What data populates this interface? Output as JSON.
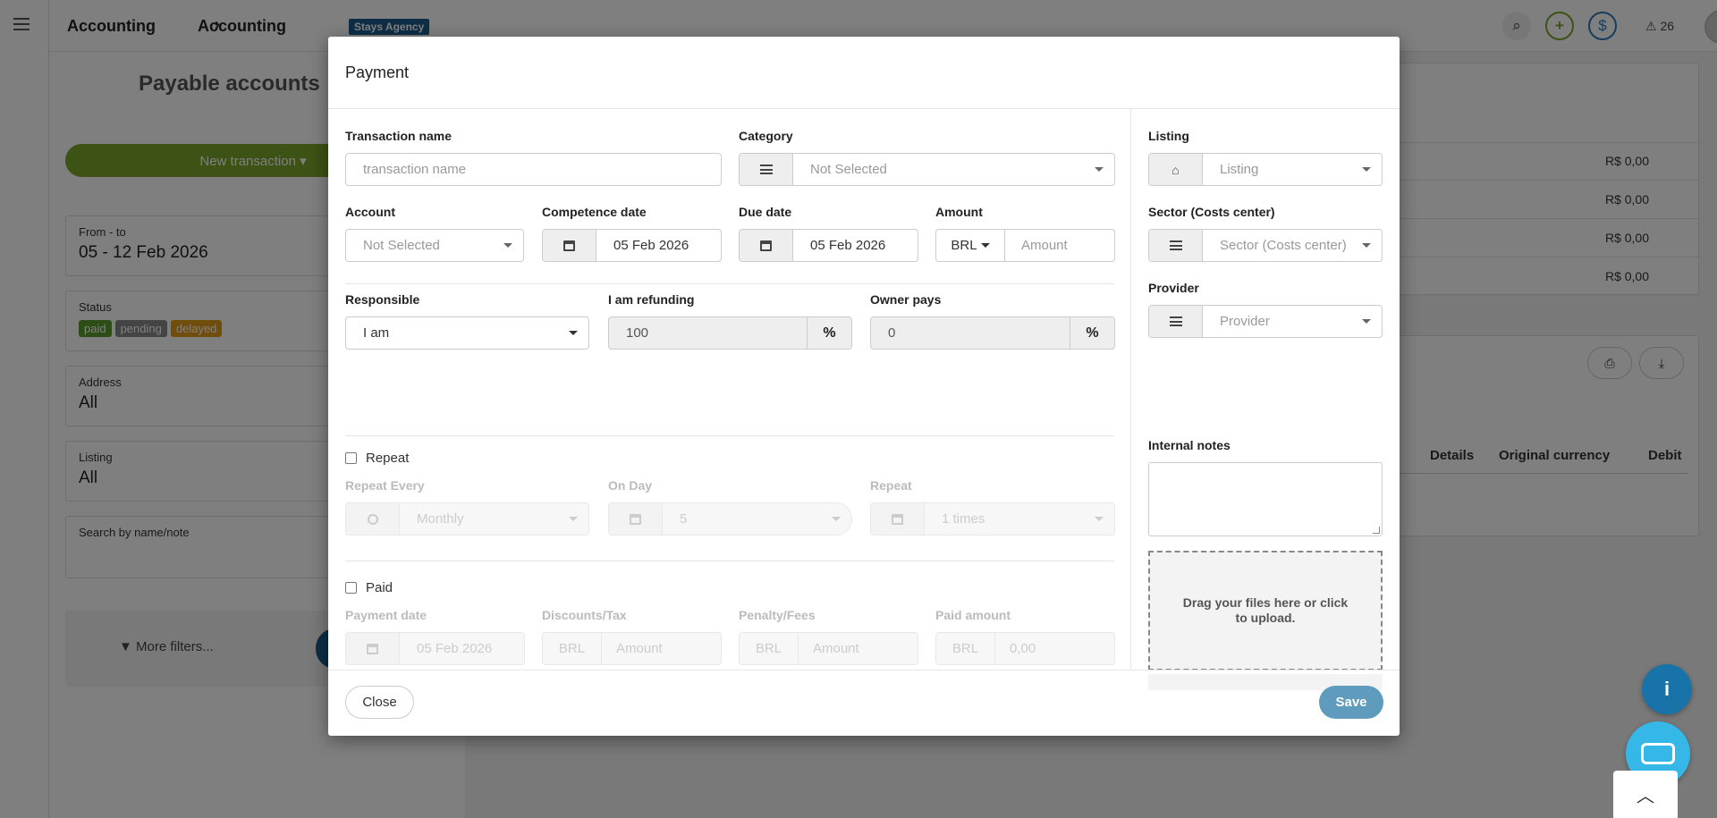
{
  "app": {
    "breadcrumb": [
      "Accounting",
      "Accounting"
    ],
    "breadcrumb_separator": "›",
    "agency_badge": "Stays Agency",
    "alerts_count": "26"
  },
  "sidebar": {
    "title": "Payable accounts",
    "new_transaction": "New transaction ▾",
    "filters": {
      "date": {
        "label": "From - to",
        "value": "05 - 12 Feb 2026"
      },
      "status": {
        "label": "Status",
        "tags": [
          "paid",
          "pending",
          "delayed"
        ]
      },
      "address": {
        "label": "Address",
        "value": "All"
      },
      "listing": {
        "label": "Listing",
        "value": "All"
      },
      "search": {
        "label": "Search by name/note"
      }
    },
    "more_filters": "More filters..."
  },
  "background": {
    "values": [
      "R$ 0,00",
      "R$ 0,00",
      "R$ 0,00",
      "R$ 0,00"
    ],
    "columns": [
      "Details",
      "Original currency",
      "Debit"
    ]
  },
  "modal": {
    "title": "Payment",
    "transaction_name": {
      "label": "Transaction name",
      "placeholder": "transaction name"
    },
    "category": {
      "label": "Category",
      "value": "Not Selected"
    },
    "account": {
      "label": "Account",
      "value": "Not Selected"
    },
    "competence_date": {
      "label": "Competence date",
      "value": "05 Feb 2026"
    },
    "due_date": {
      "label": "Due date",
      "value": "05 Feb 2026"
    },
    "amount": {
      "label": "Amount",
      "currency": "BRL",
      "placeholder": "Amount"
    },
    "responsible": {
      "label": "Responsible",
      "value": "I am"
    },
    "refunding": {
      "label": "I am refunding",
      "value": "100",
      "unit": "%"
    },
    "owner_pays": {
      "label": "Owner pays",
      "value": "0",
      "unit": "%"
    },
    "repeat": {
      "checkbox_label": "Repeat",
      "every": {
        "label": "Repeat Every",
        "value": "Monthly"
      },
      "on_day": {
        "label": "On Day",
        "value": "5"
      },
      "times": {
        "label": "Repeat",
        "value": "1 times"
      }
    },
    "paid": {
      "checkbox_label": "Paid",
      "payment_date": {
        "label": "Payment date",
        "value": "05 Feb 2026"
      },
      "discounts": {
        "label": "Discounts/Tax",
        "currency": "BRL",
        "placeholder": "Amount"
      },
      "penalty": {
        "label": "Penalty/Fees",
        "currency": "BRL",
        "placeholder": "Amount"
      },
      "paid_amount": {
        "label": "Paid amount",
        "currency": "BRL",
        "value": "0,00"
      }
    },
    "listing": {
      "label": "Listing",
      "value": "Listing"
    },
    "sector": {
      "label": "Sector (Costs center)",
      "value": "Sector (Costs center)"
    },
    "provider": {
      "label": "Provider",
      "value": "Provider"
    },
    "internal_notes": {
      "label": "Internal notes"
    },
    "dropzone_text": "Drag your files here or click to upload.",
    "close_label": "Close",
    "save_label": "Save"
  },
  "colors": {
    "accent": "#5f9bbd",
    "green": "#7aa52a",
    "brand": "#1b5d8c"
  }
}
